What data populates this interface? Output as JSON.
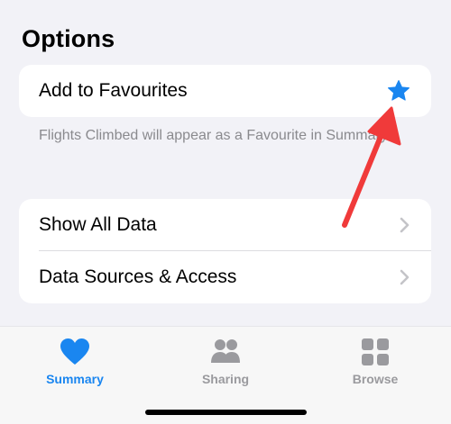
{
  "section": {
    "title": "Options"
  },
  "favourites": {
    "label": "Add to Favourites",
    "footnote": "Flights Climbed will appear as a Favourite in Summary.",
    "star_icon": "star-filled-icon",
    "star_color": "#1a86f0"
  },
  "data_rows": [
    {
      "label": "Show All Data",
      "icon": "chevron-right-icon"
    },
    {
      "label": "Data Sources & Access",
      "icon": "chevron-right-icon"
    }
  ],
  "annotation": {
    "icon": "red-arrow-icon",
    "color": "#f03a3a"
  },
  "tabbar": {
    "tabs": [
      {
        "label": "Summary",
        "icon": "heart-icon",
        "active": true
      },
      {
        "label": "Sharing",
        "icon": "people-icon",
        "active": false
      },
      {
        "label": "Browse",
        "icon": "grid-icon",
        "active": false
      }
    ],
    "active_color": "#1a86f0",
    "inactive_color": "#9a9a9e"
  }
}
